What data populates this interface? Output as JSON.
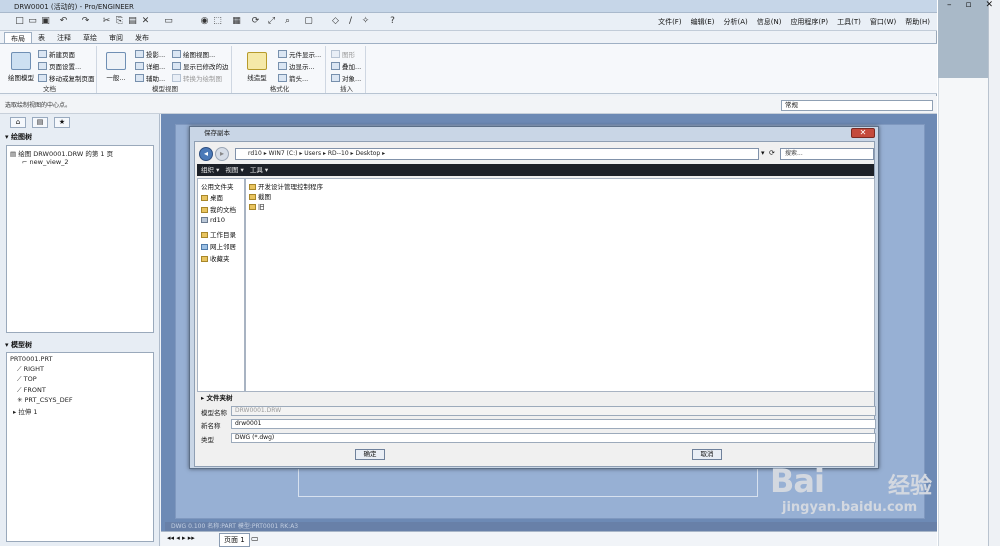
{
  "window": {
    "title": "DRW0001 (活动的) - Pro/ENGINEER"
  },
  "menu": [
    "文件(F)",
    "编辑(E)",
    "分析(A)",
    "信息(N)",
    "应用程序(P)",
    "工具(T)",
    "窗口(W)",
    "帮助(H)"
  ],
  "ribbon_tabs": [
    "布局",
    "表",
    "注释",
    "草绘",
    "审阅",
    "发布"
  ],
  "ribbon": {
    "doc": {
      "big": "绘图模型",
      "items": [
        "新建页面",
        "页面设置...",
        "移动或复制页面"
      ],
      "label": "文档"
    },
    "model_views": {
      "big": "一般...",
      "items": [
        "投影...",
        "详细...",
        "辅助..."
      ],
      "items2": [
        "绘图视图...",
        "显示已修改的边",
        "转换为绘制图"
      ],
      "label": "模型视图"
    },
    "format": {
      "big": "线造型",
      "items": [
        "元件显示...",
        "边显示...",
        "箭头..."
      ],
      "label": "格式化"
    },
    "insert": {
      "items": [
        "图形",
        "叠加...",
        "对象..."
      ],
      "label": "插入"
    }
  },
  "status_message": "选取绘制视图的中心点。",
  "filter_value": "常规",
  "drawing_tree": {
    "title": "绘图树",
    "root": "绘图 DRW0001.DRW 的第 1 页",
    "items": [
      "new_view_2"
    ]
  },
  "model_tree": {
    "title": "模型树",
    "root": "PRT0001.PRT",
    "items": [
      "RIGHT",
      "TOP",
      "FRONT",
      "PRT_CSYS_DEF",
      "拉伸 1"
    ]
  },
  "bottom_status": "DWG 0.100   名称:PART   模型:PRT0001   RK:A3",
  "page_tab": "页面 1",
  "dialog": {
    "title": "保存副本",
    "address": "rd10  ▸  WIN7 (C:)  ▸  Users  ▸  RD--10  ▸  Desktop  ▸",
    "search_placeholder": "搜索...",
    "toolbar": [
      "组织 ▾",
      "视图 ▾",
      "工具 ▾"
    ],
    "places": [
      "公用文件夹",
      "桌面",
      "我的文档",
      "rd10",
      "工作目录",
      "网上邻居",
      "收藏夹"
    ],
    "files": [
      "开发设计管理控制程序",
      "截图",
      "旧"
    ],
    "folder_tree_label": "文件夹树",
    "fields": [
      {
        "label": "模型名称",
        "value": "DRW0001.DRW"
      },
      {
        "label": "新名称",
        "value": "drw0001"
      },
      {
        "label": "类型",
        "value": "DWG (*.dwg)"
      }
    ],
    "ok": "确定",
    "cancel": "取消"
  },
  "watermark": {
    "logo": "Bai",
    "logo2": "经验",
    "url": "jingyan.baidu.com"
  }
}
